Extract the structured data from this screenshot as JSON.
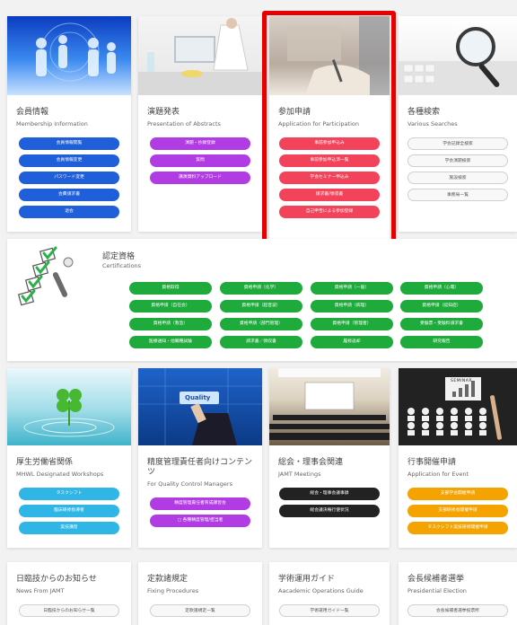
{
  "membership": {
    "title": "会員情報",
    "subtitle": "Membership Information",
    "buttons": [
      "会員情報閲覧",
      "会員情報変更",
      "パスワード変更",
      "会費請求書",
      "退会"
    ]
  },
  "abstracts": {
    "title": "演題発表",
    "subtitle": "Presentation of Abstracts",
    "buttons": [
      "演題・抄録登録",
      "質問",
      "講演資料アップロード"
    ]
  },
  "participation": {
    "title": "参加申請",
    "subtitle": "Application for Participation",
    "buttons": [
      "事前参加申込み",
      "事前参加申込済一覧",
      "学会セミナー申込み",
      "請求書/領収書",
      "自己申告による参加登録"
    ]
  },
  "search": {
    "title": "各種検索",
    "subtitle": "Various Searches",
    "buttons": [
      "学会記録全検索",
      "学会演題検索",
      "施設検索",
      "事務局一覧"
    ]
  },
  "certifications": {
    "title": "認定資格",
    "subtitle": "Certifications",
    "buttons": [
      "資格取得",
      "資格申請（化学）",
      "資格申請（一般）",
      "資格申請（心電）",
      "資格申請（自在会）",
      "資格申請（超音波）",
      "資格申請（病理）",
      "資格申請（認知症）",
      "資格申請（救急）",
      "資格申請（部門管理）",
      "資格申請（管理者）",
      "受験票・受験料請求書",
      "医療通知・他職種試験",
      "請求書／領収書",
      "履修返却",
      "研究報告"
    ]
  },
  "mhwl": {
    "title": "厚生労働省関係",
    "subtitle": "MHWL Designated Workshops",
    "buttons": [
      "タスクシフト",
      "臨床研修指導者",
      "実技講習"
    ]
  },
  "quality": {
    "title": "精度管理責任者向けコンテンツ",
    "subtitle": "For Quality Control Managers",
    "image_label": "Quality",
    "buttons": [
      "精度管理責任者育成講習会",
      "各種精度管理/担当者"
    ]
  },
  "meetings": {
    "title": "総会・理事会関連",
    "subtitle": "JAMT Meetings",
    "buttons": [
      "総会・理事会議事録",
      "総会議決権行使状況"
    ]
  },
  "event": {
    "title": "行事開催申請",
    "subtitle": "Application for Event",
    "image_label": "SEMINAR",
    "buttons": [
      "支部学会開催申請",
      "支部研修会開催申請",
      "タスクシフト実技研修開催申請"
    ]
  },
  "news": {
    "title": "日臨技からのお知らせ",
    "subtitle": "News From JAMT",
    "buttons": [
      "日臨技からのお知らせ一覧"
    ]
  },
  "fixing": {
    "title": "定款諸規定",
    "subtitle": "Fixing Procedures",
    "buttons": [
      "定款諸規定一覧"
    ]
  },
  "academic": {
    "title": "学術運用ガイド",
    "subtitle": "Aacademic Operations Guide",
    "buttons": [
      "学術運用ガイド一覧"
    ]
  },
  "election": {
    "title": "会長候補者選挙",
    "subtitle": "Presidential Election",
    "buttons": [
      "会長候補者選挙投票所"
    ]
  },
  "colors": {
    "blue": "#1f5fd9",
    "purple": "#b23ce3",
    "red": "#f3435a",
    "green": "#1faa3c",
    "cyan": "#2fb6e6",
    "black": "#222222",
    "orange": "#f5a300",
    "highlight": "#e60000"
  }
}
